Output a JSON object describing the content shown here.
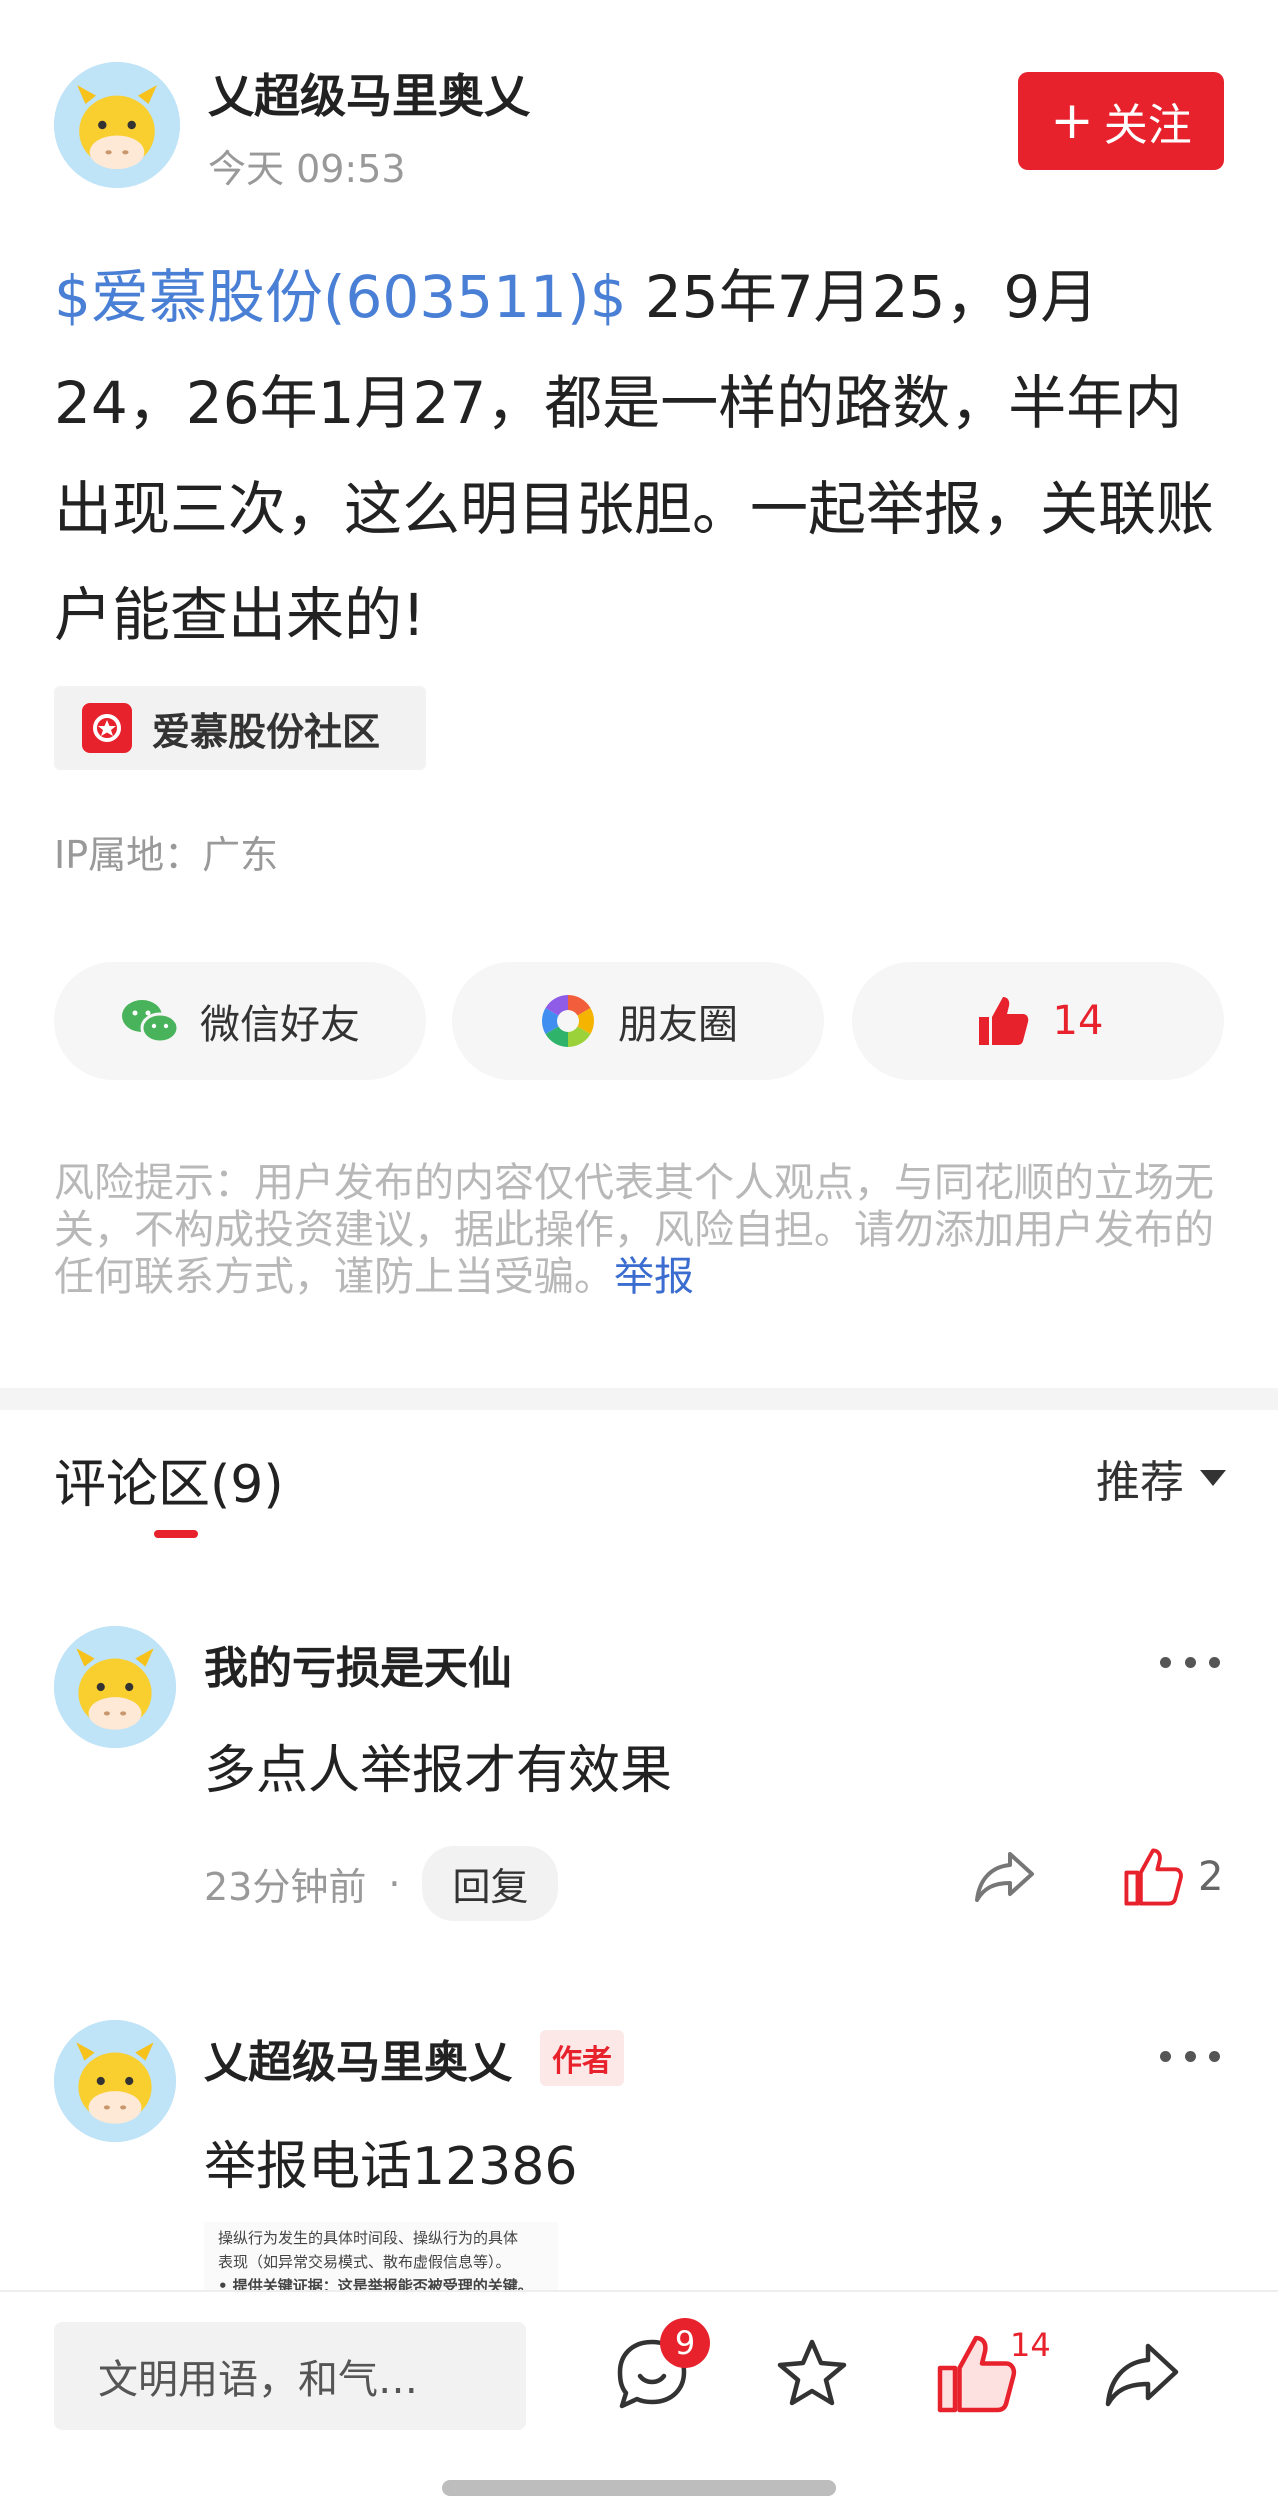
{
  "post": {
    "author_name": "乂超级马里奥乂",
    "time": "今天 09:53",
    "follow_label": "关注",
    "stock_tag": "$爱慕股份(603511)$",
    "text": " 25年7月25，9月24，26年1月27，都是一样的路数，半年内出现三次，这么明目张胆。一起举报，关联账户能查出来的!",
    "community": "爱慕股份社区",
    "ip_location": "IP属地：广东"
  },
  "share": {
    "wechat_label": "微信好友",
    "moments_label": "朋友圈",
    "like_count": "14"
  },
  "risk": {
    "text": "风险提示：用户发布的内容仅代表其个人观点，与同花顺的立场无关，不构成投资建议，据此操作，风险自担。请勿添加用户发布的任何联系方式，谨防上当受骗。",
    "report_label": "举报"
  },
  "comments_section": {
    "title": "评论区(9)",
    "sort_label": "推荐"
  },
  "comments": [
    {
      "name": "我的亏损是天仙",
      "text": "多点人举报才有效果",
      "time": "23分钟前",
      "reply_label": "回复",
      "likes": "2"
    },
    {
      "name": "乂超级马里奥乂",
      "badge": "作者",
      "text": "举报电话12386",
      "image_lines": [
        "操纵行为发生的具体时间段、操纵行为的具体",
        "表现（如异常交易模式、散布虚假信息等）。",
        "• 提供关键证据：这是举报能否被受理的关键。"
      ]
    }
  ],
  "bottom_bar": {
    "input_placeholder": "文明用语，和气…",
    "comment_count": "9",
    "like_count": "14"
  },
  "colors": {
    "accent_red": "#e8222d",
    "link_blue": "#4a7fd6",
    "avatar_bg": "#bfe3f7"
  }
}
